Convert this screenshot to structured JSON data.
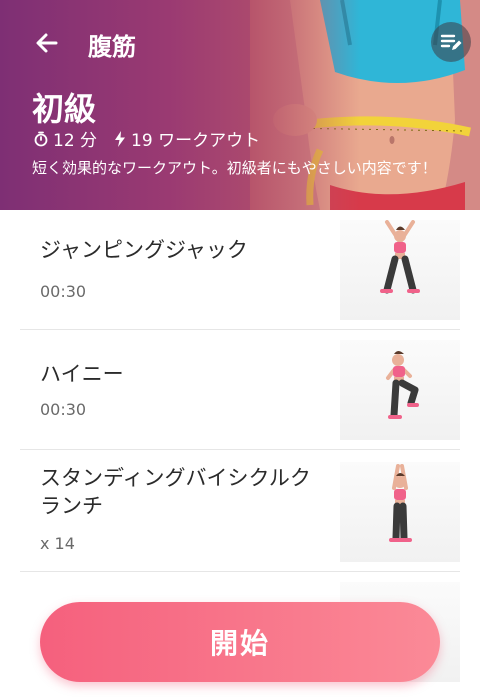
{
  "header": {
    "title": "腹筋",
    "level": "初級",
    "duration": "12 分",
    "workout_count": "19 ワークアウト",
    "description": "短く効果的なワークアウト。初級者にもやさしい内容です！",
    "gradient_start": "#7e2f74",
    "gradient_end": "#c96b6f"
  },
  "icons": {
    "back": "arrow-left",
    "edit": "playlist-edit",
    "duration": "stopwatch",
    "workouts": "lightning-bolt"
  },
  "exercises": [
    {
      "name": "ジャンピングジャック",
      "value": "00:30"
    },
    {
      "name": "ハイニー",
      "value": "00:30"
    },
    {
      "name": "スタンディングバイシクルクランチ",
      "value": "x 14"
    },
    {
      "name": "",
      "value": ""
    }
  ],
  "start_button": {
    "label": "開始",
    "color": "#f5607d"
  }
}
